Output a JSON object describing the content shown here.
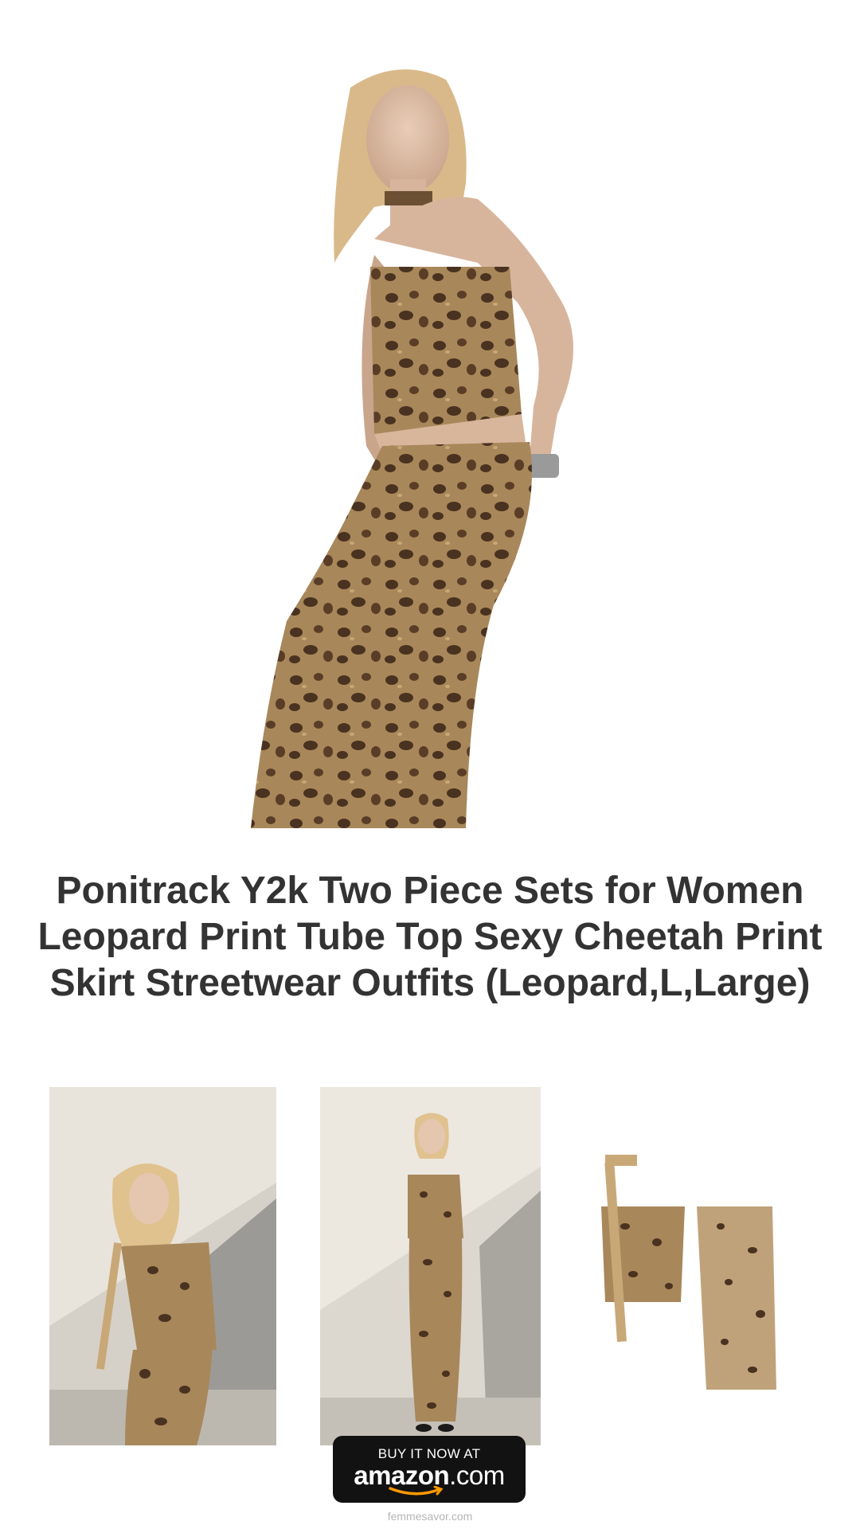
{
  "product": {
    "title": "Ponitrack Y2k Two Piece Sets for Women Leopard Print Tube Top Sexy Cheetah Print Skirt Streetwear Outfits (Leopard,L,Large)"
  },
  "images": {
    "hero": "model-leopard-set-photo",
    "thumbnails": [
      "model-pose-wall-photo",
      "model-full-length-photo",
      "flat-lay-top-skirt-photo"
    ]
  },
  "cta": {
    "small_label": "BUY IT NOW AT",
    "brand": "amazon",
    "suffix": ".com"
  },
  "footer": {
    "site": "femmesavor.com"
  },
  "colors": {
    "leopard_base": "#a8875a",
    "leopard_spot": "#4a3220",
    "button_bg": "#121212",
    "smile": "#ff9900"
  }
}
